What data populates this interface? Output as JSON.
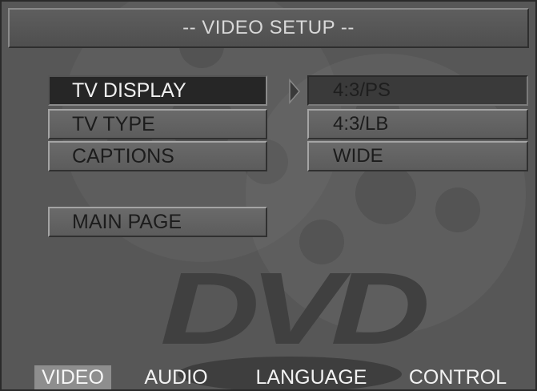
{
  "header": {
    "title": "-- VIDEO SETUP --"
  },
  "menu": {
    "items": [
      {
        "label": "TV DISPLAY",
        "selected": true
      },
      {
        "label": "TV TYPE",
        "selected": false
      },
      {
        "label": "CAPTIONS",
        "selected": false
      }
    ],
    "main_page_label": "MAIN PAGE"
  },
  "options": {
    "items": [
      {
        "label": "4:3/PS",
        "highlighted": true
      },
      {
        "label": "4:3/LB",
        "highlighted": false
      },
      {
        "label": "WIDE",
        "highlighted": false
      }
    ]
  },
  "tabs": [
    {
      "label": "VIDEO",
      "active": true
    },
    {
      "label": "AUDIO",
      "active": false
    },
    {
      "label": "LANGUAGE",
      "active": false
    },
    {
      "label": "CONTROL",
      "active": false
    }
  ],
  "logo": {
    "text": "DVD"
  },
  "colors": {
    "background": "#575757",
    "selected_item": "#262626",
    "active_tab": "#8e8e8e"
  }
}
